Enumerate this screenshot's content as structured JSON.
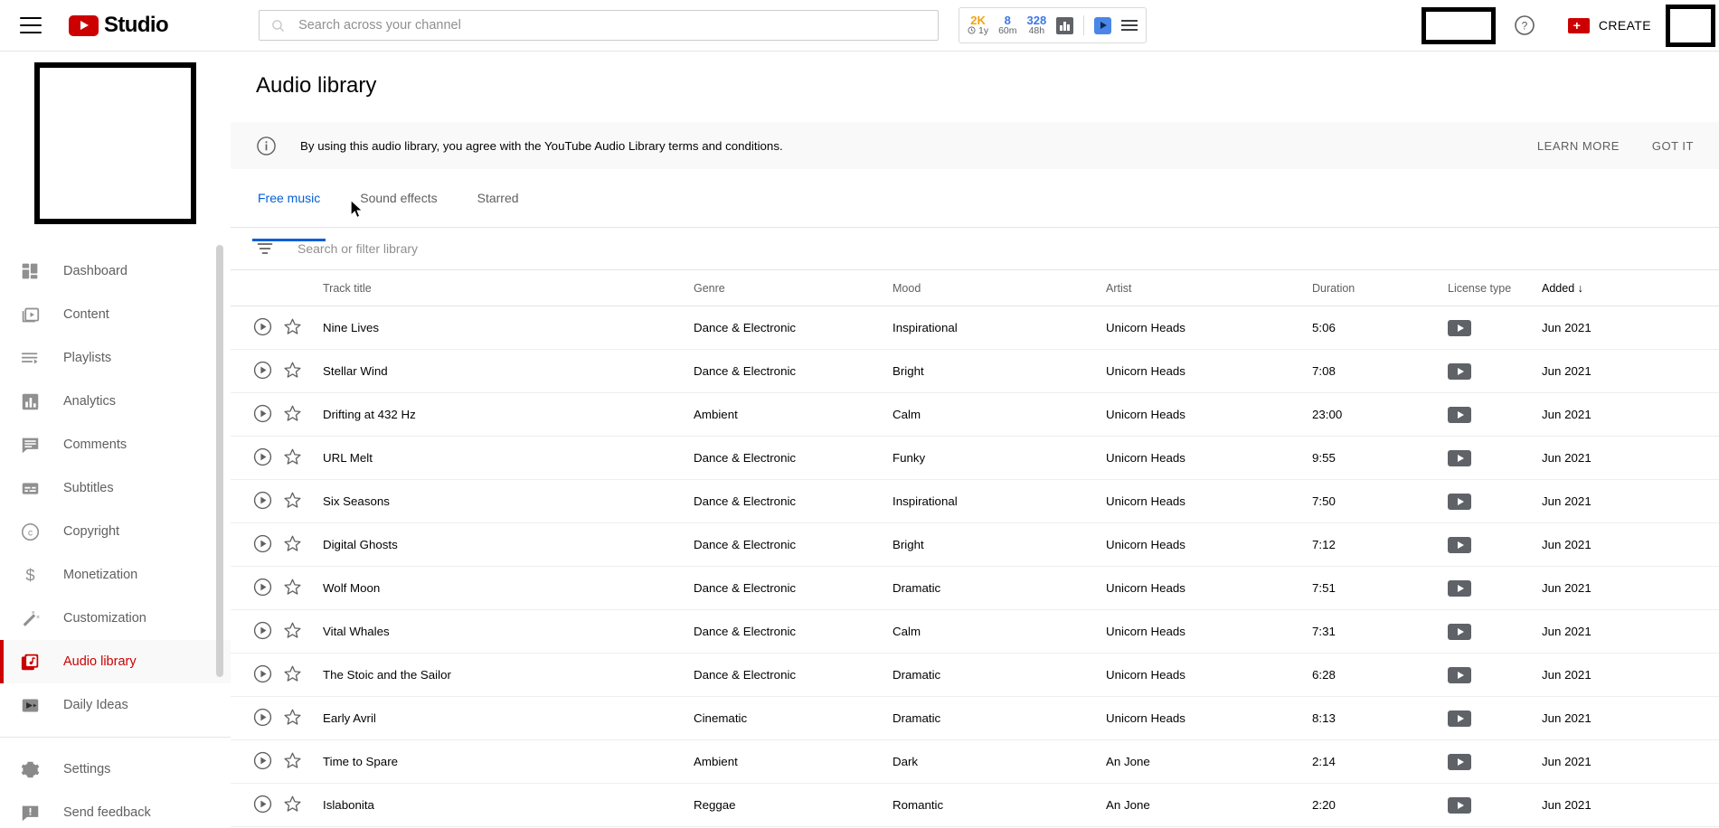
{
  "header": {
    "menu_icon": "hamburger-icon",
    "brand": "Studio",
    "search": {
      "placeholder": "Search across your channel",
      "value": "",
      "icon": "search-icon"
    },
    "stats": [
      {
        "value": "2K",
        "sub": "1y",
        "icon": "clock-icon"
      },
      {
        "value": "8",
        "sub": "60m",
        "icon": ""
      },
      {
        "value": "328",
        "sub": "48h",
        "icon": ""
      }
    ],
    "stats_icons": {
      "analytics": "bar-chart-icon",
      "player": "blue-play-icon",
      "menu": "list-icon"
    },
    "help_label": "help-icon",
    "create_label": "CREATE"
  },
  "sidebar": {
    "items": [
      {
        "label": "Dashboard",
        "icon": "dashboard-grid-icon"
      },
      {
        "label": "Content",
        "icon": "content-video-icon"
      },
      {
        "label": "Playlists",
        "icon": "playlists-icon"
      },
      {
        "label": "Analytics",
        "icon": "analytics-bar-icon"
      },
      {
        "label": "Comments",
        "icon": "comments-icon"
      },
      {
        "label": "Subtitles",
        "icon": "subtitles-icon"
      },
      {
        "label": "Copyright",
        "icon": "copyright-icon"
      },
      {
        "label": "Monetization",
        "icon": "dollar-icon"
      },
      {
        "label": "Customization",
        "icon": "magic-wand-icon"
      },
      {
        "label": "Audio library",
        "icon": "audio-library-icon"
      },
      {
        "label": "Daily Ideas",
        "icon": "daily-ideas-icon"
      }
    ],
    "footer_items": [
      {
        "label": "Settings",
        "icon": "gear-icon"
      },
      {
        "label": "Send feedback",
        "icon": "feedback-icon"
      }
    ],
    "active": "Audio library"
  },
  "main": {
    "title": "Audio library",
    "notice": {
      "icon": "info-icon",
      "text": "By using this audio library, you agree with the YouTube Audio Library terms and conditions.",
      "learn_more": "LEARN MORE",
      "got_it": "GOT IT"
    },
    "tabs": [
      {
        "label": "Free music",
        "active": true
      },
      {
        "label": "Sound effects",
        "active": false
      },
      {
        "label": "Starred",
        "active": false
      }
    ],
    "filter": {
      "icon": "filter-icon",
      "placeholder": "Search or filter library",
      "value": ""
    },
    "columns": [
      {
        "key": "title",
        "label": "Track title",
        "sorted": false
      },
      {
        "key": "genre",
        "label": "Genre",
        "sorted": false
      },
      {
        "key": "mood",
        "label": "Mood",
        "sorted": false
      },
      {
        "key": "artist",
        "label": "Artist",
        "sorted": false
      },
      {
        "key": "duration",
        "label": "Duration",
        "sorted": false
      },
      {
        "key": "license",
        "label": "License type",
        "sorted": false
      },
      {
        "key": "added",
        "label": "Added",
        "sorted": true,
        "sort_icon": "↓"
      }
    ],
    "rows": [
      {
        "title": "Nine Lives",
        "genre": "Dance & Electronic",
        "mood": "Inspirational",
        "artist": "Unicorn Heads",
        "duration": "5:06",
        "license": "youtube-badge",
        "added": "Jun 2021"
      },
      {
        "title": "Stellar Wind",
        "genre": "Dance & Electronic",
        "mood": "Bright",
        "artist": "Unicorn Heads",
        "duration": "7:08",
        "license": "youtube-badge",
        "added": "Jun 2021"
      },
      {
        "title": "Drifting at 432 Hz",
        "genre": "Ambient",
        "mood": "Calm",
        "artist": "Unicorn Heads",
        "duration": "23:00",
        "license": "youtube-badge",
        "added": "Jun 2021"
      },
      {
        "title": "URL Melt",
        "genre": "Dance & Electronic",
        "mood": "Funky",
        "artist": "Unicorn Heads",
        "duration": "9:55",
        "license": "youtube-badge",
        "added": "Jun 2021"
      },
      {
        "title": "Six Seasons",
        "genre": "Dance & Electronic",
        "mood": "Inspirational",
        "artist": "Unicorn Heads",
        "duration": "7:50",
        "license": "youtube-badge",
        "added": "Jun 2021"
      },
      {
        "title": "Digital Ghosts",
        "genre": "Dance & Electronic",
        "mood": "Bright",
        "artist": "Unicorn Heads",
        "duration": "7:12",
        "license": "youtube-badge",
        "added": "Jun 2021"
      },
      {
        "title": "Wolf Moon",
        "genre": "Dance & Electronic",
        "mood": "Dramatic",
        "artist": "Unicorn Heads",
        "duration": "7:51",
        "license": "youtube-badge",
        "added": "Jun 2021"
      },
      {
        "title": "Vital Whales",
        "genre": "Dance & Electronic",
        "mood": "Calm",
        "artist": "Unicorn Heads",
        "duration": "7:31",
        "license": "youtube-badge",
        "added": "Jun 2021"
      },
      {
        "title": "The Stoic and the Sailor",
        "genre": "Dance & Electronic",
        "mood": "Dramatic",
        "artist": "Unicorn Heads",
        "duration": "6:28",
        "license": "youtube-badge",
        "added": "Jun 2021"
      },
      {
        "title": "Early Avril",
        "genre": "Cinematic",
        "mood": "Dramatic",
        "artist": "Unicorn Heads",
        "duration": "8:13",
        "license": "youtube-badge",
        "added": "Jun 2021"
      },
      {
        "title": "Time to Spare",
        "genre": "Ambient",
        "mood": "Dark",
        "artist": "An Jone",
        "duration": "2:14",
        "license": "youtube-badge",
        "added": "Jun 2021"
      },
      {
        "title": "Islabonita",
        "genre": "Reggae",
        "mood": "Romantic",
        "artist": "An Jone",
        "duration": "2:20",
        "license": "youtube-badge",
        "added": "Jun 2021"
      }
    ]
  },
  "colors": {
    "brand_red": "#cc0000",
    "active_red": "#cc0000",
    "tab_blue": "#065fd4",
    "stat_yellow": "#f2a20c",
    "stat_blue": "#3b78e7",
    "text": "#030303",
    "muted": "#606060"
  }
}
